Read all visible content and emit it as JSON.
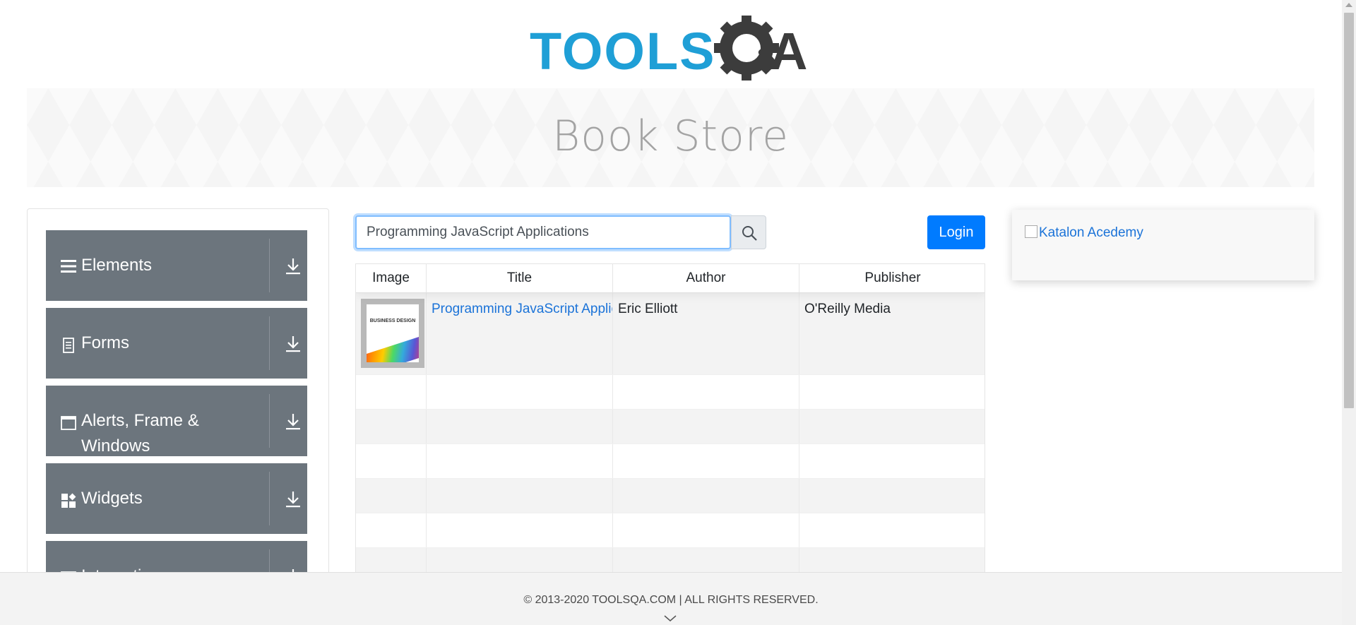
{
  "header": {
    "logo_text_left": "TOOLS",
    "logo_text_right": "A",
    "page_title": "Book Store"
  },
  "sidebar": {
    "groups": [
      {
        "label": "Elements",
        "icon": "hamburger-icon"
      },
      {
        "label": "Forms",
        "icon": "document-icon"
      },
      {
        "label": "Alerts, Frame &",
        "label_line2": "Windows",
        "icon": "window-icon"
      },
      {
        "label": "Widgets",
        "icon": "widgets-icon"
      },
      {
        "label": "Interactions",
        "icon": "interactions-icon"
      }
    ]
  },
  "search": {
    "value": "Programming JavaScript Applications",
    "button_icon": "search-icon"
  },
  "login": {
    "label": "Login"
  },
  "table": {
    "headers": [
      "Image",
      "Title",
      "Author",
      "Publisher"
    ],
    "rows": [
      {
        "cover_title": "BUSINESS DESIGN",
        "title": "Programming JavaScript Applications",
        "author": "Eric Elliott",
        "publisher": "O'Reilly Media"
      }
    ],
    "empty_rows": 6
  },
  "ad": {
    "alt": "Katalon Acedemy"
  },
  "footer": {
    "copyright": "© 2013-2020 TOOLSQA.COM | ALL RIGHTS RESERVED."
  },
  "colors": {
    "logo_blue": "#1f9fd6",
    "logo_dark": "#3c3c3c",
    "sidebar_bg": "#6c757d",
    "primary": "#007bff",
    "link": "#1b73d8"
  }
}
